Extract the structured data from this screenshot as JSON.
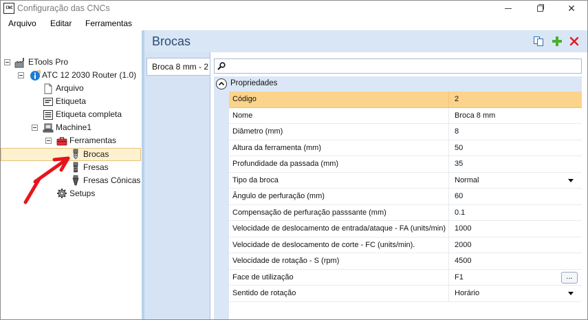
{
  "window": {
    "app_icon_text": "CNC",
    "title": "Configuração das CNCs"
  },
  "menu": {
    "items": [
      "Arquivo",
      "Editar",
      "Ferramentas"
    ]
  },
  "tree": {
    "root": "ETools Pro",
    "machine_group": "ATC 12 2030 Router (1.0)",
    "arquivo": "Arquivo",
    "etiqueta": "Etiqueta",
    "etiqueta_completa": "Etiqueta completa",
    "machine": "Machine1",
    "ferramentas": "Ferramentas",
    "brocas": "Brocas",
    "fresas": "Fresas",
    "fresas_conicas": "Fresas Cônicas",
    "setups": "Setups"
  },
  "header": {
    "title": "Brocas"
  },
  "tabs": {
    "items": [
      "Broca 8 mm - 2"
    ]
  },
  "search": {
    "value": "",
    "placeholder": ""
  },
  "properties": {
    "category": "Propriedades",
    "rows": [
      {
        "name": "Código",
        "value": "2"
      },
      {
        "name": "Nome",
        "value": "Broca 8 mm"
      },
      {
        "name": "Diâmetro (mm)",
        "value": "8"
      },
      {
        "name": "Altura da ferramenta (mm)",
        "value": "50"
      },
      {
        "name": "Profundidade da passada (mm)",
        "value": "35"
      },
      {
        "name": "Tipo da broca",
        "value": "Normal"
      },
      {
        "name": "Ângulo de perfuração (mm)",
        "value": "60"
      },
      {
        "name": "Compensação de perfuração passsante (mm)",
        "value": "0.1"
      },
      {
        "name": "Velocidade de deslocamento de entrada/ataque - FA (units/min)",
        "value": "1000"
      },
      {
        "name": "Velocidade de deslocamento de corte - FC (units/min).",
        "value": "2000"
      },
      {
        "name": "Velocidade de rotação - S (rpm)",
        "value": "4500"
      },
      {
        "name": "Face de utilização",
        "value": "F1"
      },
      {
        "name": "Sentido de rotação",
        "value": "Horário"
      }
    ],
    "ellipsis_label": "..."
  },
  "colors": {
    "selection": "#fbd38b",
    "header_bg": "#d9e6f5",
    "title_color": "#2b4c72",
    "annotation_arrow": "#e8141b"
  }
}
